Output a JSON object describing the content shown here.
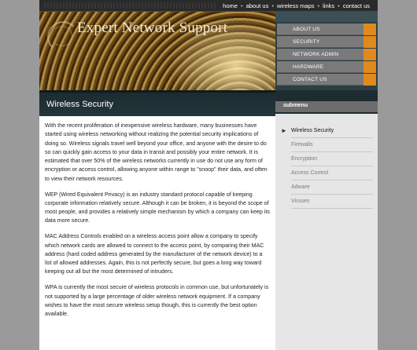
{
  "top_nav": {
    "links": [
      "home",
      "about us",
      "wireless maps",
      "links",
      "contact us"
    ],
    "separator": "•"
  },
  "header": {
    "site_title": "Expert Network Support"
  },
  "main_menu": {
    "items": [
      "ABOUT US",
      "SECURITY",
      "NETWORK ADMIN",
      "HARDWARE",
      "CONTACT US"
    ]
  },
  "page": {
    "title": "Wireless Security"
  },
  "submenu": {
    "label": "submenu",
    "items": [
      {
        "label": "Wireless Security",
        "active": true
      },
      {
        "label": "Firewalls",
        "active": false
      },
      {
        "label": "Encryption",
        "active": false
      },
      {
        "label": "Access Control",
        "active": false
      },
      {
        "label": "Adware",
        "active": false
      },
      {
        "label": "Viruses",
        "active": false
      }
    ],
    "bullet": "►"
  },
  "content": {
    "paragraphs": [
      "With the recent proliferation of inexpensive wireless hardware, many businesses have started using wireless networking without realizing the potential security implications of doing so. Wireless signals travel well beyond your office, and anyone with the desire to do so can quickly gain access to your data in transit and possibly your entire network. It is estimated that over 50% of the wireless networks currently in use do not use any form of encryption or access control, allowing anyone within range to \"snoop\" their data, and often to view their network resources.",
      "WEP (Wired Equivalent Privacy) is an industry standard protocol capable of keeping corporate information relatively secure. Although it can be broken, it is beyond the scope of most people, and provides a relatively simple mechanism by which a company can keep its data more secure.",
      "MAC Address Controls enabled on a wireless access point allow a company to specify which network cards are allowed to connect to the access point, by comparing their MAC address (hard coded address generated by the manufacturer of the network device) to a list of allowed addresses. Again, this is not perfectly secure, but goes a long way toward keeping out all but the most determined of intruders.",
      "WPA is currently the most secure of wireless protocols in common use, but unfortunately is not supported by a large percentage of older wireless network equipment. If a company wishes to have the most secure wireless setup though, this is currently the best option available."
    ]
  },
  "colors": {
    "accent_orange": "#e08a1e",
    "dark_teal": "#1c2b30",
    "menu_gray": "#7a7a7a"
  }
}
